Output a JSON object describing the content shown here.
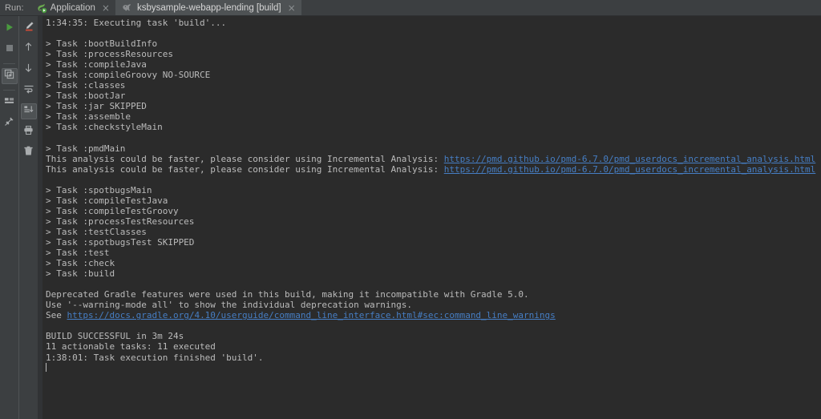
{
  "window": {
    "run_label": "Run:",
    "accent_link_color": "#467ec4",
    "console_bg": "#2b2b2b",
    "chrome_bg": "#3c3f41"
  },
  "tabs": [
    {
      "id": "application",
      "label": "Application",
      "icon": "spring-boot-leaf-icon",
      "active": false,
      "close_glyph": "×"
    },
    {
      "id": "gradle-build",
      "label": "ksbysample-webapp-lending [build]",
      "icon": "gradle-elephant-icon",
      "active": true,
      "close_glyph": "×"
    }
  ],
  "toolbar_left": [
    {
      "id": "rerun",
      "name": "rerun-button",
      "tooltip": "Rerun"
    },
    {
      "id": "stop",
      "name": "stop-button",
      "tooltip": "Stop"
    },
    {
      "id": "restart-toggle",
      "name": "restart-button",
      "tooltip": "Restart",
      "selected": true
    },
    {
      "id": "layout",
      "name": "layout-button",
      "tooltip": "Layout"
    },
    {
      "id": "pin",
      "name": "pin-tab-button",
      "tooltip": "Pin Tab"
    }
  ],
  "toolbar_right": [
    {
      "id": "highlight",
      "name": "highlight-button",
      "tooltip": "Highlight"
    },
    {
      "id": "up",
      "name": "previous-occurrence-button",
      "tooltip": "Up"
    },
    {
      "id": "down",
      "name": "next-occurrence-button",
      "tooltip": "Down"
    },
    {
      "id": "softwrap",
      "name": "soft-wrap-button",
      "tooltip": "Soft-Wrap"
    },
    {
      "id": "scroll-end",
      "name": "scroll-to-end-button",
      "tooltip": "Scroll to End",
      "selected": true
    },
    {
      "id": "print",
      "name": "print-button",
      "tooltip": "Print"
    },
    {
      "id": "clear",
      "name": "clear-all-button",
      "tooltip": "Clear All"
    }
  ],
  "console": {
    "lines": [
      {
        "text": "1:34:35: Executing task 'build'..."
      },
      {
        "text": ""
      },
      {
        "text": "> Task :bootBuildInfo"
      },
      {
        "text": "> Task :processResources"
      },
      {
        "text": "> Task :compileJava"
      },
      {
        "text": "> Task :compileGroovy NO-SOURCE"
      },
      {
        "text": "> Task :classes"
      },
      {
        "text": "> Task :bootJar"
      },
      {
        "text": "> Task :jar SKIPPED"
      },
      {
        "text": "> Task :assemble"
      },
      {
        "text": "> Task :checkstyleMain"
      },
      {
        "text": ""
      },
      {
        "text": "> Task :pmdMain"
      },
      {
        "text": "This analysis could be faster, please consider using Incremental Analysis: ",
        "link": "https://pmd.github.io/pmd-6.7.0/pmd_userdocs_incremental_analysis.html"
      },
      {
        "text": "This analysis could be faster, please consider using Incremental Analysis: ",
        "link": "https://pmd.github.io/pmd-6.7.0/pmd_userdocs_incremental_analysis.html"
      },
      {
        "text": ""
      },
      {
        "text": "> Task :spotbugsMain"
      },
      {
        "text": "> Task :compileTestJava"
      },
      {
        "text": "> Task :compileTestGroovy"
      },
      {
        "text": "> Task :processTestResources"
      },
      {
        "text": "> Task :testClasses"
      },
      {
        "text": "> Task :spotbugsTest SKIPPED"
      },
      {
        "text": "> Task :test"
      },
      {
        "text": "> Task :check"
      },
      {
        "text": "> Task :build"
      },
      {
        "text": ""
      },
      {
        "text": "Deprecated Gradle features were used in this build, making it incompatible with Gradle 5.0."
      },
      {
        "text": "Use '--warning-mode all' to show the individual deprecation warnings."
      },
      {
        "text": "See ",
        "link": "https://docs.gradle.org/4.10/userguide/command_line_interface.html#sec:command_line_warnings"
      },
      {
        "text": ""
      },
      {
        "text": "BUILD SUCCESSFUL in 3m 24s"
      },
      {
        "text": "11 actionable tasks: 11 executed"
      },
      {
        "text": "1:38:01: Task execution finished 'build'."
      },
      {
        "text": "",
        "caret": true
      }
    ]
  }
}
